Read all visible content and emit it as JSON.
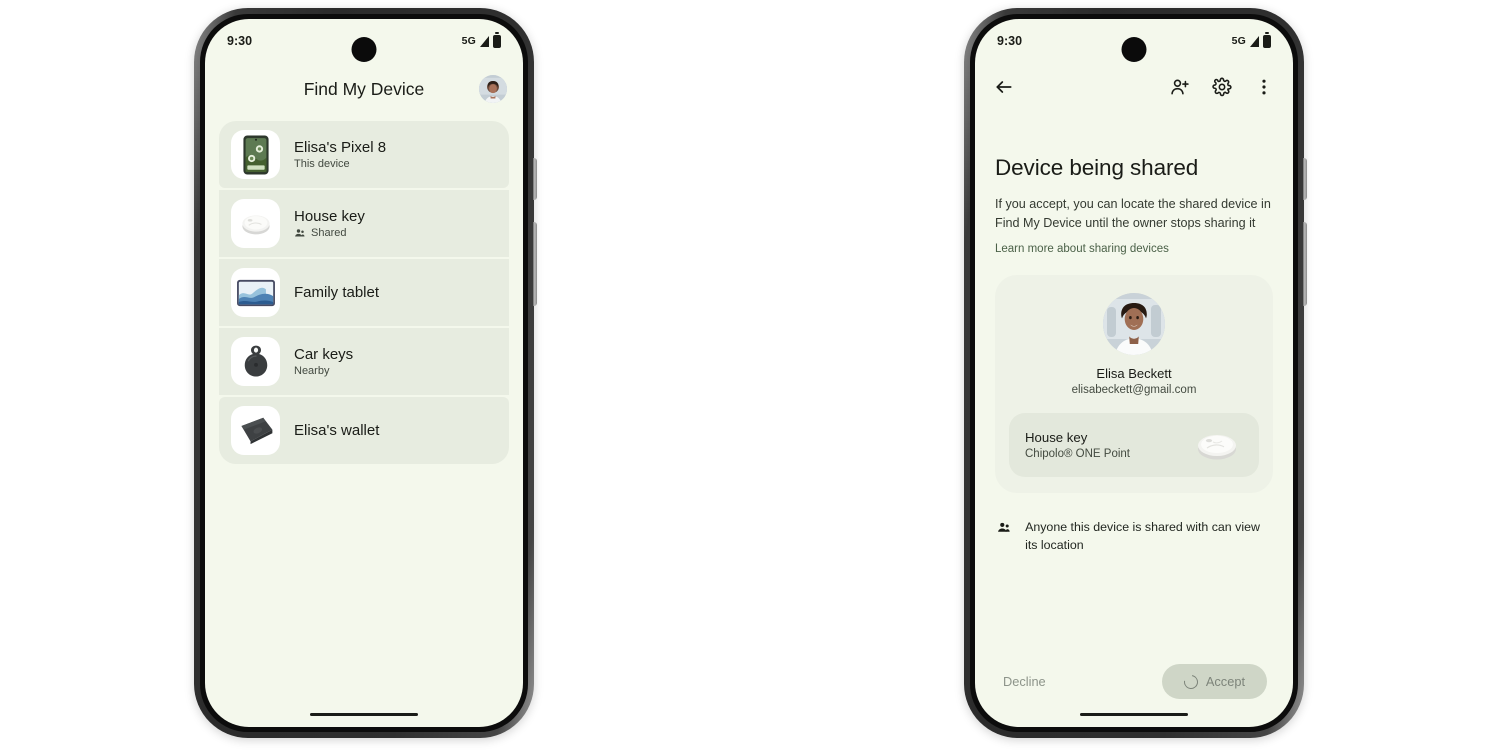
{
  "left_phone": {
    "status_bar": {
      "time": "9:30",
      "network": "5G",
      "signal_icon": "signal-bars-icon",
      "battery_icon": "battery-icon"
    },
    "app_bar": {
      "title": "Find My Device",
      "avatar_icon": "account-avatar"
    },
    "devices": [
      {
        "name": "Elisa's Pixel 8",
        "sub": "This device",
        "sub_icon": "",
        "icon": "pixel-phone-thumbnail"
      },
      {
        "name": "House key",
        "sub": "Shared",
        "sub_icon": "people-shared-icon",
        "icon": "chipolo-tag-thumbnail"
      },
      {
        "name": "Family tablet",
        "sub": "",
        "sub_icon": "",
        "icon": "tablet-thumbnail"
      },
      {
        "name": "Car keys",
        "sub": "Nearby",
        "sub_icon": "",
        "icon": "keytag-thumbnail"
      },
      {
        "name": "Elisa's wallet",
        "sub": "",
        "sub_icon": "",
        "icon": "wallet-thumbnail"
      }
    ]
  },
  "right_phone": {
    "status_bar": {
      "time": "9:30",
      "network": "5G",
      "signal_icon": "signal-bars-icon",
      "battery_icon": "battery-icon"
    },
    "top_bar": {
      "back_icon": "arrow-back-icon",
      "add_person_icon": "person-add-icon",
      "settings_icon": "gear-icon",
      "overflow_icon": "more-vert-icon"
    },
    "content": {
      "heading": "Device being shared",
      "body": "If you accept, you can locate the shared device in Find My Device until the owner stops sharing it",
      "link": "Learn more about sharing devices",
      "owner": {
        "avatar_icon": "owner-profile-photo",
        "name": "Elisa Beckett",
        "email": "elisabeckett@gmail.com"
      },
      "shared_device": {
        "name": "House key",
        "model": "Chipolo® ONE Point",
        "image_icon": "chipolo-one-point-image"
      },
      "notice": {
        "icon": "people-group-icon",
        "text": "Anyone this device is shared with can view its location"
      }
    },
    "footer": {
      "decline_label": "Decline",
      "accept_label": "Accept",
      "accept_spinner_icon": "loading-spinner-icon"
    }
  },
  "colors": {
    "screen_background": "#f4f8ec",
    "list_item_background": "#e7ece0",
    "card_background": "#eef2e7",
    "tag_card_background": "#e3e8dc",
    "primary_text": "#1a1c17",
    "secondary_text": "#444b41",
    "link_text": "#4b6148",
    "disabled_button_background": "#cfd6c7",
    "disabled_button_text": "#7d847a"
  }
}
